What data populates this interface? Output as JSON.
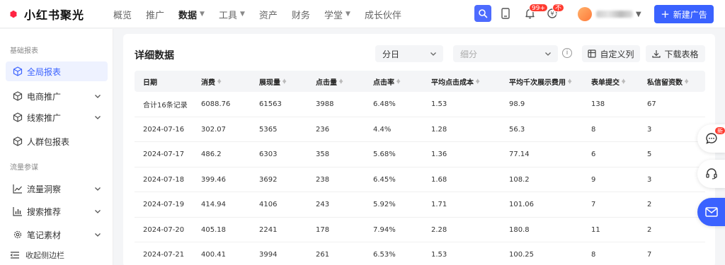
{
  "brand": {
    "name": "小红书聚光"
  },
  "nav": [
    {
      "label": "概览",
      "active": false,
      "dropdown": false
    },
    {
      "label": "推广",
      "active": false,
      "dropdown": false
    },
    {
      "label": "数据",
      "active": true,
      "dropdown": true
    },
    {
      "label": "工具",
      "active": false,
      "dropdown": true
    },
    {
      "label": "资产",
      "active": false,
      "dropdown": false
    },
    {
      "label": "财务",
      "active": false,
      "dropdown": false
    },
    {
      "label": "学堂",
      "active": false,
      "dropdown": true
    },
    {
      "label": "成长伙伴",
      "active": false,
      "dropdown": false
    }
  ],
  "topbar": {
    "icons": [
      "search-icon",
      "tablet-icon",
      "bell-icon",
      "coin-icon"
    ],
    "notifications_badge": "99+",
    "balance_badge": "不足",
    "new_ad_label": "新建广告"
  },
  "sidebar": {
    "section1": "基础报表",
    "section2": "流量参谋",
    "items": [
      {
        "label": "全局报表",
        "icon": "cube-icon",
        "active": true,
        "expandable": false
      },
      {
        "label": "电商推广",
        "icon": "cube-icon",
        "active": false,
        "expandable": true
      },
      {
        "label": "线索推广",
        "icon": "cube-icon",
        "active": false,
        "expandable": true
      },
      {
        "label": "人群包报表",
        "icon": "cube-icon",
        "active": false,
        "expandable": false
      },
      {
        "label": "流量洞察",
        "icon": "trend-icon",
        "active": false,
        "expandable": true
      },
      {
        "label": "搜索推荐",
        "icon": "bar-chart-icon",
        "active": false,
        "expandable": true
      },
      {
        "label": "笔记素材",
        "icon": "gear-icon",
        "active": false,
        "expandable": true
      }
    ],
    "collapse_label": "收起侧边栏"
  },
  "main": {
    "title": "详细数据",
    "granularity_value": "分日",
    "breakdown_placeholder": "细分",
    "custom_columns_label": "自定义列",
    "download_label": "下载表格"
  },
  "table": {
    "columns": [
      "日期",
      "消费",
      "展现量",
      "点击量",
      "点击率",
      "平均点击成本",
      "平均千次展示费用",
      "表单提交",
      "私信留资数"
    ],
    "sortable": [
      false,
      true,
      true,
      true,
      true,
      true,
      true,
      true,
      true
    ],
    "rows": [
      [
        "合计16条记录",
        "6088.76",
        "61563",
        "3988",
        "6.48%",
        "1.53",
        "98.9",
        "138",
        "67"
      ],
      [
        "2024-07-16",
        "302.07",
        "5365",
        "236",
        "4.4%",
        "1.28",
        "56.3",
        "8",
        "3"
      ],
      [
        "2024-07-17",
        "486.2",
        "6303",
        "358",
        "5.68%",
        "1.36",
        "77.14",
        "6",
        "5"
      ],
      [
        "2024-07-18",
        "399.46",
        "3692",
        "238",
        "6.45%",
        "1.68",
        "108.2",
        "9",
        "3"
      ],
      [
        "2024-07-19",
        "414.94",
        "4106",
        "243",
        "5.92%",
        "1.71",
        "101.06",
        "7",
        "2"
      ],
      [
        "2024-07-20",
        "405.18",
        "2241",
        "178",
        "7.94%",
        "2.28",
        "180.8",
        "11",
        "2"
      ],
      [
        "2024-07-21",
        "400.41",
        "3994",
        "261",
        "6.53%",
        "1.53",
        "100.25",
        "8",
        "7"
      ]
    ]
  },
  "float": {
    "message_badge": "新"
  },
  "colors": {
    "accent": "#3a62ff",
    "brand": "#ff2442",
    "badge": "#ff3b30"
  }
}
